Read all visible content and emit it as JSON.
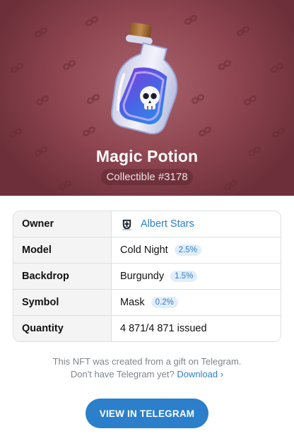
{
  "hero": {
    "title": "Magic Potion",
    "subtitle": "Collectible #3178",
    "backdrop_color": "#8e4550",
    "gift_icon": "potion-bottle-skull",
    "pattern_icon": "mask-icon"
  },
  "details": {
    "owner": {
      "label": "Owner",
      "name": "Albert Stars",
      "avatar_icon": "crest-avatar"
    },
    "model": {
      "label": "Model",
      "value": "Cold Night",
      "rarity": "2.5%"
    },
    "backdrop": {
      "label": "Backdrop",
      "value": "Burgundy",
      "rarity": "1.5%"
    },
    "symbol": {
      "label": "Symbol",
      "value": "Mask",
      "rarity": "0.2%"
    },
    "quantity": {
      "label": "Quantity",
      "value": "4 871/4 871 issued"
    }
  },
  "footer": {
    "line1": "This NFT was created from a gift on Telegram.",
    "line2_prefix": "Don't have Telegram yet?",
    "download_label": "Download ›"
  },
  "cta": {
    "label": "VIEW IN TELEGRAM",
    "color": "#2b7fcb"
  }
}
